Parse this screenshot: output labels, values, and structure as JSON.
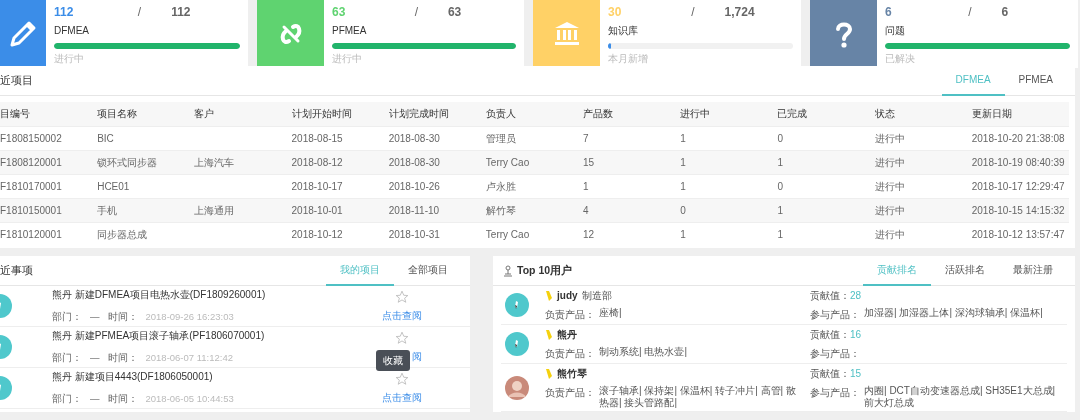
{
  "stats": [
    {
      "kind": "dfmea",
      "color": "#3b8de8",
      "value": "112",
      "separator": "/",
      "total": "112",
      "label": "DFMEA",
      "level": 1,
      "caption": "进行中"
    },
    {
      "kind": "pfmea",
      "color": "#5fd370",
      "value": "63",
      "separator": "/",
      "total": "63",
      "label": "PFMEA",
      "level": 1,
      "caption": "进行中"
    },
    {
      "kind": "knowledge",
      "color": "#ffd166",
      "value": "30",
      "separator": "/",
      "total": "1,724",
      "label": "知识库",
      "level": 0.017,
      "caption": "本月新增"
    },
    {
      "kind": "issue",
      "color": "#6784a6",
      "value": "6",
      "separator": "/",
      "total": "6",
      "label": "问题",
      "level": 1,
      "caption": "已解决"
    }
  ],
  "projects": {
    "title": "近项目",
    "tabs": [
      {
        "label": "DFMEA",
        "selected": true
      },
      {
        "label": "PFMEA",
        "selected": false
      }
    ],
    "table": {
      "columns": [
        "目编号",
        "项目名称",
        "客户",
        "计划开始时间",
        "计划完成时间",
        "负责人",
        "产品数",
        "进行中",
        "已完成",
        "状态",
        "更新日期"
      ],
      "rows": [
        [
          "F1808150002",
          "BIC",
          "",
          "2018-08-15",
          "2018-08-30",
          "管理员",
          "7",
          "1",
          "0",
          "进行中",
          "2018-10-20 21:38:08"
        ],
        [
          "F1808120001",
          "锁环式同步器",
          "上海汽车",
          "2018-08-12",
          "2018-08-30",
          "Terry Cao",
          "15",
          "1",
          "1",
          "进行中",
          "2018-10-19 08:40:39"
        ],
        [
          "F1810170001",
          "HCE01",
          "",
          "2018-10-17",
          "2018-10-26",
          "卢永胜",
          "1",
          "1",
          "0",
          "进行中",
          "2018-10-17 12:29:47"
        ],
        [
          "F1810150001",
          "手机",
          "上海通用",
          "2018-10-01",
          "2018-11-10",
          "解竹琴",
          "4",
          "0",
          "1",
          "进行中",
          "2018-10-15 14:15:32"
        ],
        [
          "F1810120001",
          "同步器总成",
          "",
          "2018-10-12",
          "2018-10-31",
          "Terry Cao",
          "12",
          "1",
          "1",
          "进行中",
          "2018-10-12 13:57:47"
        ]
      ]
    }
  },
  "recent": {
    "title": "近事项",
    "tabs": [
      {
        "label": "我的项目",
        "selected": true
      },
      {
        "label": "全部项目",
        "selected": false
      }
    ],
    "items": [
      {
        "title": "熊丹 新建DFMEA项目电热水壶(DF1809260001)",
        "dept_label": "部门：",
        "dept": "—",
        "time_label": "时间：",
        "time": "2018-09-26 16:23:03",
        "link": "点击查阅"
      },
      {
        "title": "熊丹 新建PFMEA项目滚子轴承(PF1806070001)",
        "dept_label": "部门：",
        "dept": "—",
        "time_label": "时间：",
        "time": "2018-06-07 11:12:42",
        "link": "阅",
        "tooltip": "收藏"
      },
      {
        "title": "熊丹 新建项目4443(DF1806050001)",
        "dept_label": "部门：",
        "dept": "—",
        "time_label": "时间：",
        "time": "2018-06-05 10:44:53",
        "link": "点击查阅"
      }
    ]
  },
  "top_users": {
    "title": "Top 10用户",
    "tabs": [
      {
        "label": "贡献排名",
        "selected": true
      },
      {
        "label": "活跃排名",
        "selected": false
      },
      {
        "label": "最新注册",
        "selected": false
      }
    ],
    "users": [
      {
        "kind": "icon",
        "name": "judy",
        "dept": "制造部",
        "owned_label": "负责产品：",
        "owned": "座椅|",
        "score_label": "贡献值：",
        "score": "28",
        "joined_label": "参与产品：",
        "joined": "加湿器| 加湿器上体| 深沟球轴承| 保温杯|"
      },
      {
        "kind": "icon",
        "name": "熊丹",
        "owned_label": "负责产品：",
        "owned": "制动系统| 电热水壶|",
        "score_label": "贡献值：",
        "score": "16",
        "joined_label": "参与产品："
      },
      {
        "kind": "photo",
        "name": "熊竹琴",
        "owned_label": "负责产品：",
        "owned": "滚子轴承| 保持架| 保温杯| 转子冲片| 高管| 散热器| 接头管路配|",
        "score_label": "贡献值：",
        "score": "15",
        "joined_label": "参与产品：",
        "joined": "内圈| DCT自动变速器总成| SH35E1大总成| 前大灯总成"
      }
    ]
  }
}
